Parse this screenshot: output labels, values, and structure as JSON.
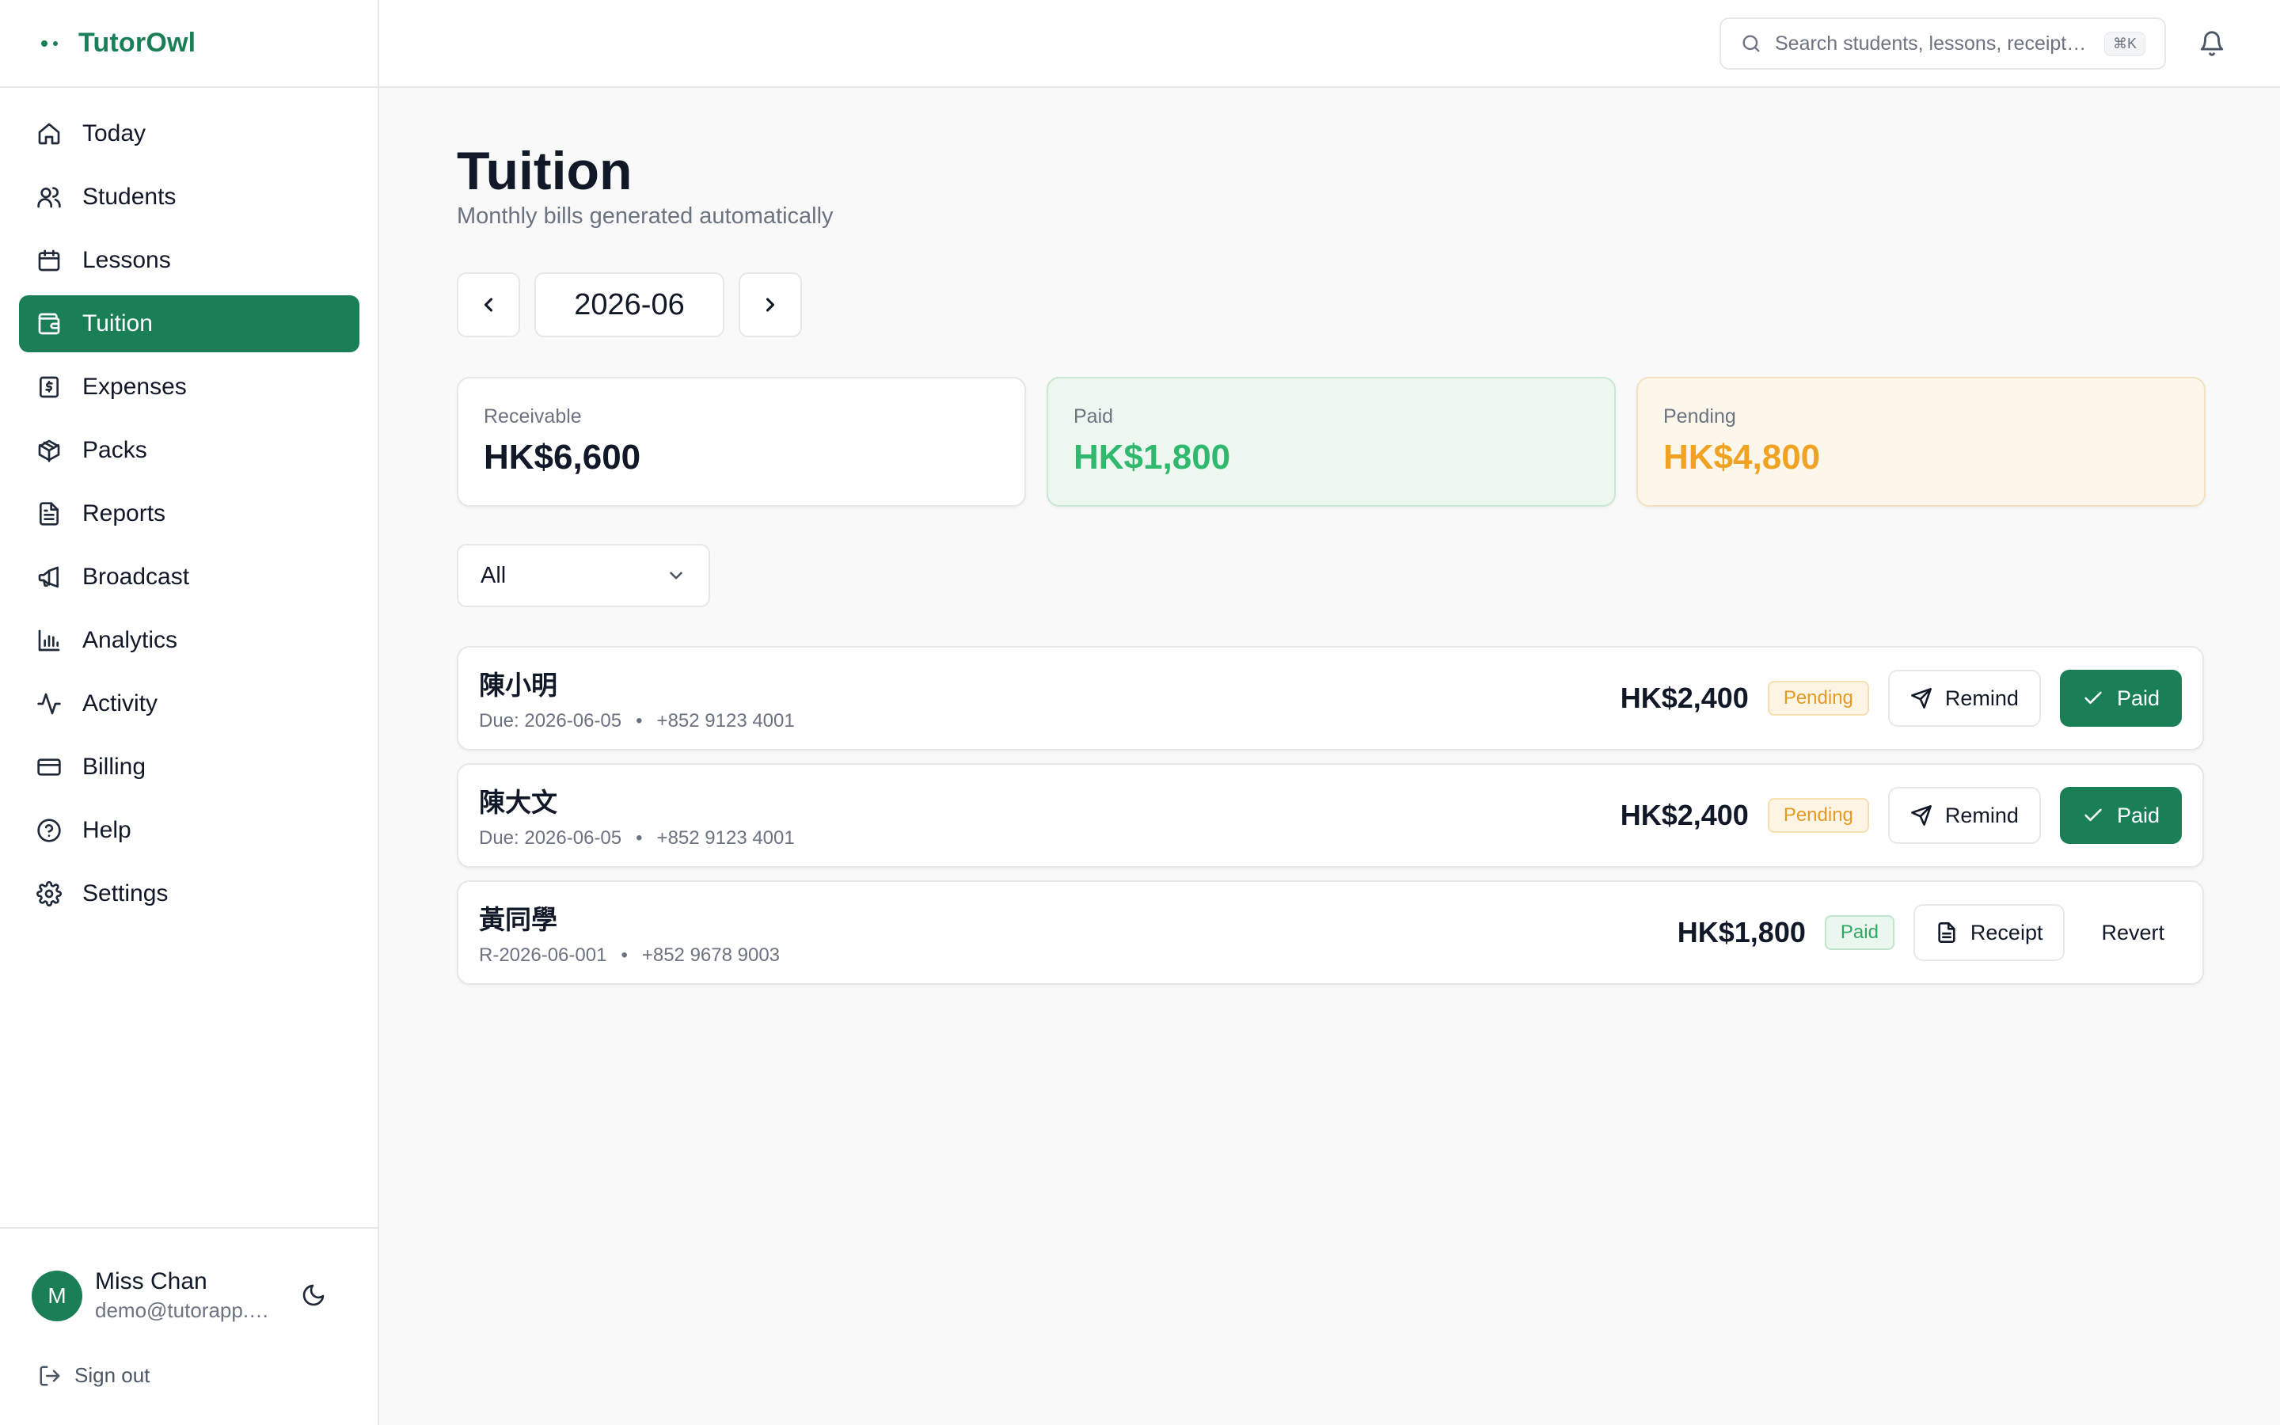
{
  "app": {
    "name": "TutorOwl",
    "brand_color": "#1a7f57"
  },
  "sidebar": {
    "items": [
      {
        "label": "Today",
        "icon": "home-icon",
        "active": false
      },
      {
        "label": "Students",
        "icon": "users-icon",
        "active": false
      },
      {
        "label": "Lessons",
        "icon": "calendar-icon",
        "active": false
      },
      {
        "label": "Tuition",
        "icon": "wallet-icon",
        "active": true
      },
      {
        "label": "Expenses",
        "icon": "receipt-icon",
        "active": false
      },
      {
        "label": "Packs",
        "icon": "package-icon",
        "active": false
      },
      {
        "label": "Reports",
        "icon": "file-text-icon",
        "active": false
      },
      {
        "label": "Broadcast",
        "icon": "megaphone-icon",
        "active": false
      },
      {
        "label": "Analytics",
        "icon": "bar-chart-icon",
        "active": false
      },
      {
        "label": "Activity",
        "icon": "activity-icon",
        "active": false
      },
      {
        "label": "Billing",
        "icon": "credit-card-icon",
        "active": false
      },
      {
        "label": "Help",
        "icon": "help-circle-icon",
        "active": false
      },
      {
        "label": "Settings",
        "icon": "gear-icon",
        "active": false
      }
    ],
    "user": {
      "initial": "M",
      "name": "Miss Chan",
      "email": "demo@tutorapp.…"
    },
    "signout_label": "Sign out"
  },
  "topbar": {
    "search_placeholder": "Search students, lessons, receipts…",
    "shortcut": "⌘K"
  },
  "page": {
    "title": "Tuition",
    "subtitle": "Monthly bills generated automatically",
    "month": "2026-06"
  },
  "stats": {
    "receivable": {
      "label": "Receivable",
      "value": "HK$6,600"
    },
    "paid": {
      "label": "Paid",
      "value": "HK$1,800"
    },
    "pending": {
      "label": "Pending",
      "value": "HK$4,800"
    }
  },
  "filter": {
    "value": "All"
  },
  "bills": [
    {
      "name": "陳小明",
      "meta": "Due: 2026-06-05",
      "phone": "+852 9123 4001",
      "amount": "HK$2,400",
      "status": "Pending",
      "action1": "Remind",
      "action2": "Paid"
    },
    {
      "name": "陳大文",
      "meta": "Due: 2026-06-05",
      "phone": "+852 9123 4001",
      "amount": "HK$2,400",
      "status": "Pending",
      "action1": "Remind",
      "action2": "Paid"
    },
    {
      "name": "黃同學",
      "meta": "R-2026-06-001",
      "phone": "+852 9678 9003",
      "amount": "HK$1,800",
      "status": "Paid",
      "action1": "Receipt",
      "action2": "Revert"
    }
  ],
  "colors": {
    "accent": "#1a7f57",
    "paid": "#2fb86e",
    "pending": "#f0a323"
  }
}
